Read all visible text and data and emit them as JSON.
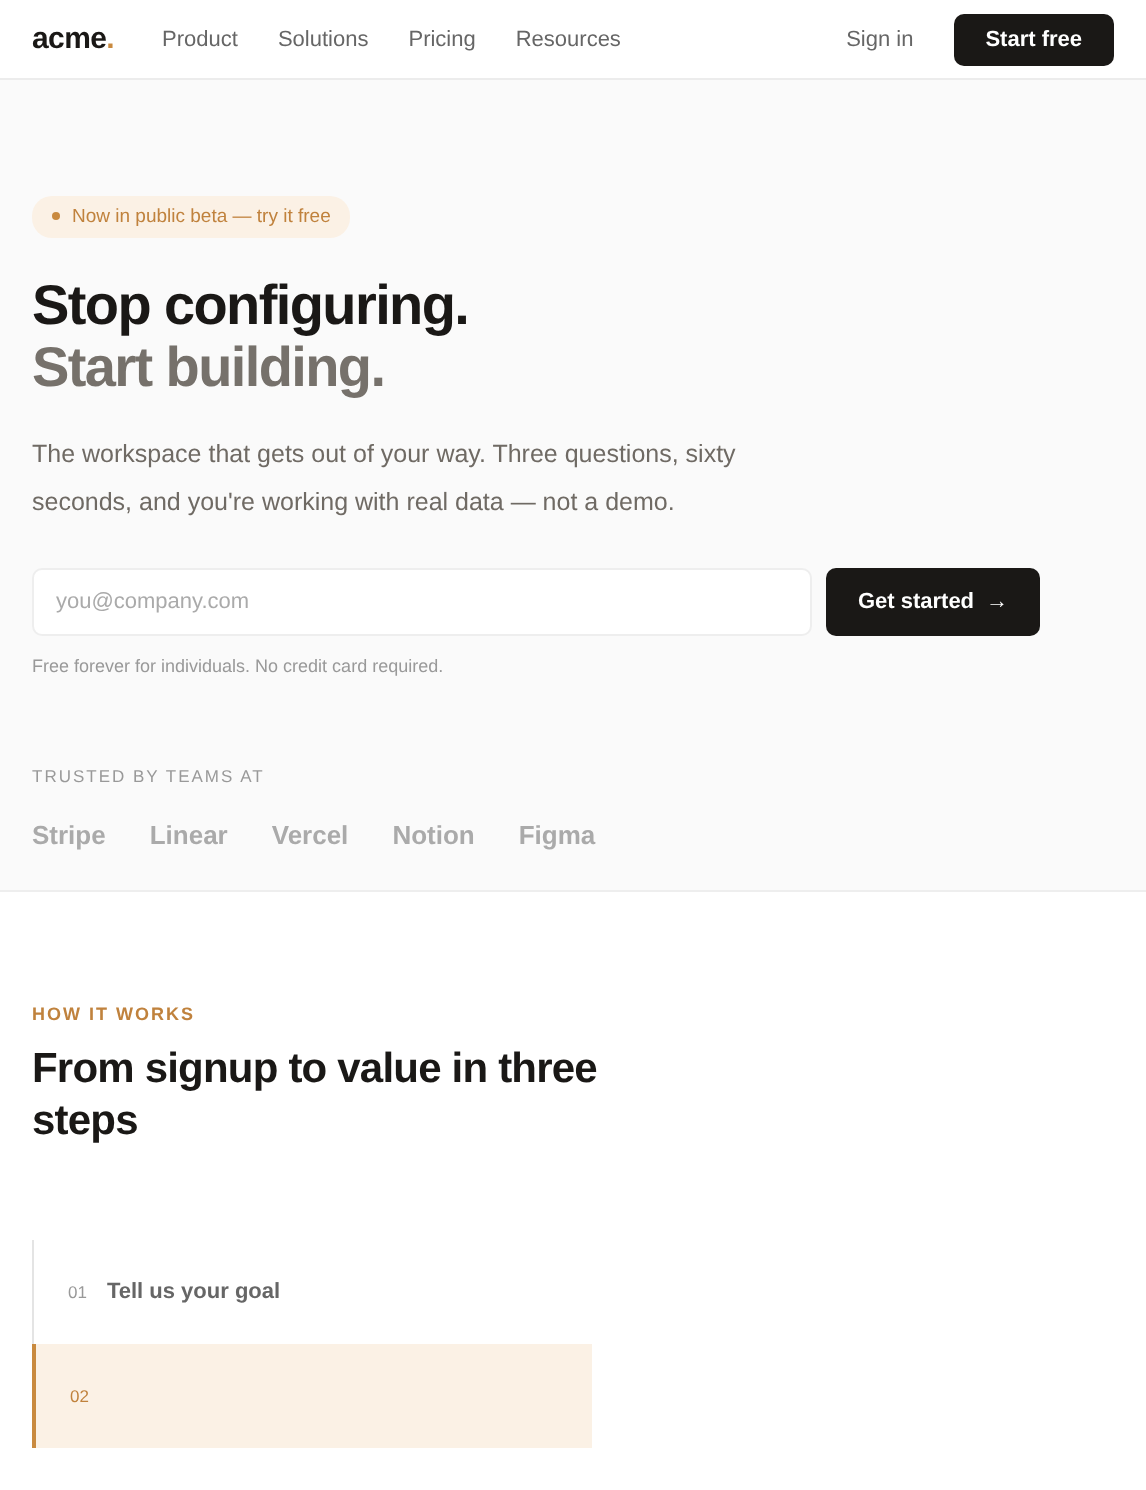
{
  "nav": {
    "logo": "acme",
    "logo_dot": ".",
    "links": [
      "Product",
      "Solutions",
      "Pricing",
      "Resources"
    ],
    "sign_in": "Sign in",
    "cta": "Start free"
  },
  "hero": {
    "badge": "Now in public beta — try it free",
    "title_line1": "Stop configuring.",
    "title_line2": "Start building.",
    "lead": "The workspace that gets out of your way. Three questions, sixty seconds, and you're working with real data — not a demo.",
    "email": {
      "placeholder": "you@company.com"
    },
    "submit": "Get started",
    "submit_arrow": "→",
    "note": "Free forever for individuals. No credit card required.",
    "trusted_label": "TRUSTED BY TEAMS AT",
    "logos": [
      "Stripe",
      "Linear",
      "Vercel",
      "Notion",
      "Figma"
    ]
  },
  "how": {
    "eyebrow": "HOW IT WORKS",
    "title": "From signup to value in three steps",
    "steps": [
      {
        "number": "01",
        "title": "Tell us your goal",
        "selected": false
      },
      {
        "number": "02",
        "selected": true
      }
    ]
  }
}
